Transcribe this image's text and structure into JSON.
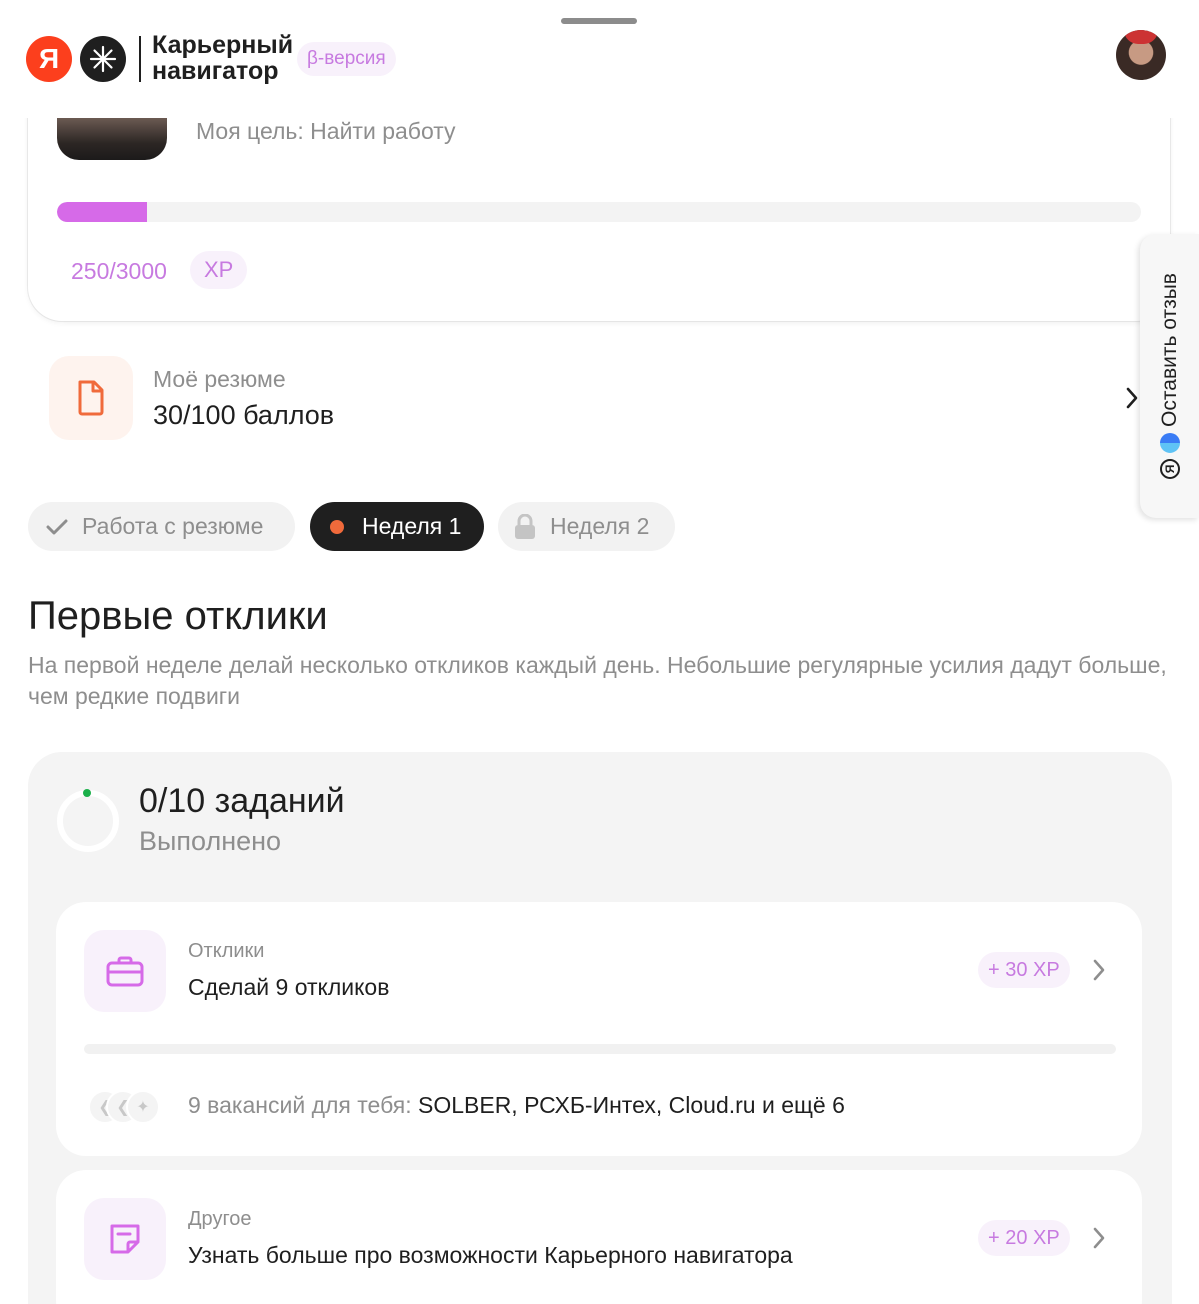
{
  "header": {
    "ya_logo_letter": "Я",
    "brand_title": "Карьерный навигатор",
    "beta_badge": "β-версия"
  },
  "profile": {
    "goal": "Моя цель: Найти работу",
    "xp_progress": 0.0833,
    "xp_counter": "250/3000",
    "xp_unit": "XP"
  },
  "resume": {
    "label": "Моё резюме",
    "score": "30/100 баллов"
  },
  "feedback": {
    "ya_letter": "Я",
    "label": "Оставить отзыв"
  },
  "chips": [
    {
      "label": "Работа с резюме",
      "state": "done"
    },
    {
      "label": "Неделя 1",
      "state": "active"
    },
    {
      "label": "Неделя 2",
      "state": "locked"
    }
  ],
  "section": {
    "title": "Первые отклики",
    "description": "На первой неделе делай несколько откликов каждый день. Небольшие регулярные усилия дадут больше, чем редкие подвиги"
  },
  "tasks_summary": {
    "count": "0/10 заданий",
    "status": "Выполнено"
  },
  "tasks": [
    {
      "category": "Отклики",
      "title": "Сделай 9 откликов",
      "xp": "+ 30 XP",
      "progress": 0,
      "vacancies_prefix": "9 вакансий для тебя:",
      "vacancies_names": "SOLBER, РСХБ-Интех, Cloud.ru и ещё 6"
    },
    {
      "category": "Другое",
      "title": "Узнать больше про возможности Карьерного навигатора",
      "xp": "+ 20 XP"
    }
  ],
  "colors": {
    "accent_purple": "#d66ae8",
    "badge_text": "#c77ae0",
    "orange": "#f06a3b",
    "ya_red": "#fc3f1d"
  }
}
